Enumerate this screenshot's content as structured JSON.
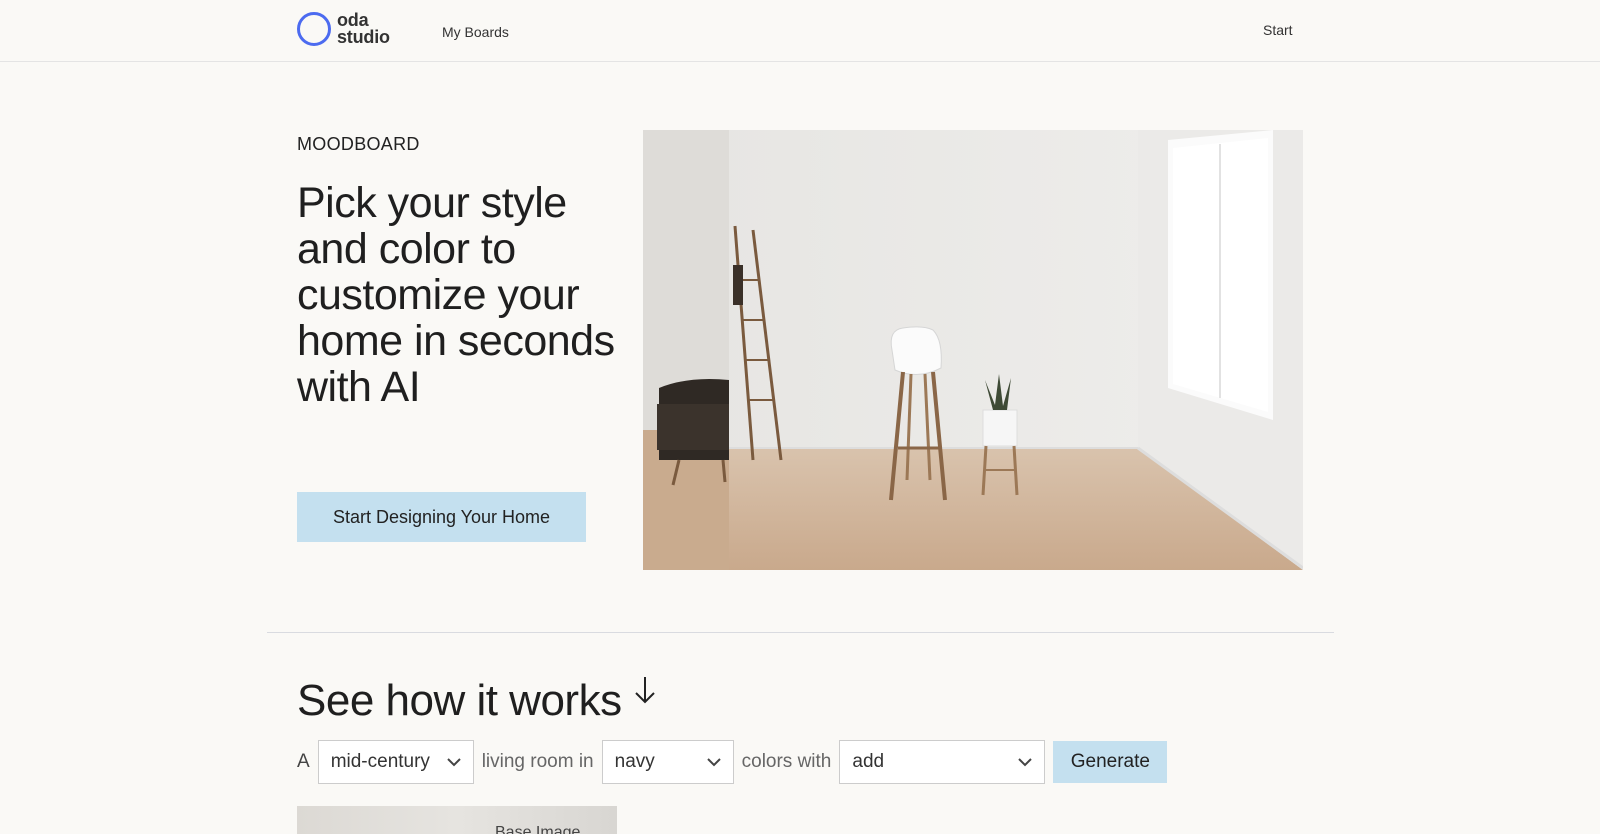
{
  "header": {
    "logo_line1": "oda",
    "logo_line2": "studio",
    "nav_my_boards": "My Boards",
    "start": "Start"
  },
  "hero": {
    "eyebrow": "MOODBOARD",
    "headline": "Pick your style and color to customize your home in seconds with AI",
    "cta": "Start Designing Your Home"
  },
  "how": {
    "title": "See how it works",
    "word_a": "A",
    "style_value": "mid-century",
    "word_room": "living room in",
    "color_value": "navy",
    "word_colors": "colors with",
    "add_value": "add",
    "generate": "Generate",
    "preview_label": "Base Image"
  },
  "colors": {
    "accent": "#4c6bf0",
    "button_bg": "#c4e0ef",
    "page_bg": "#faf9f6"
  }
}
